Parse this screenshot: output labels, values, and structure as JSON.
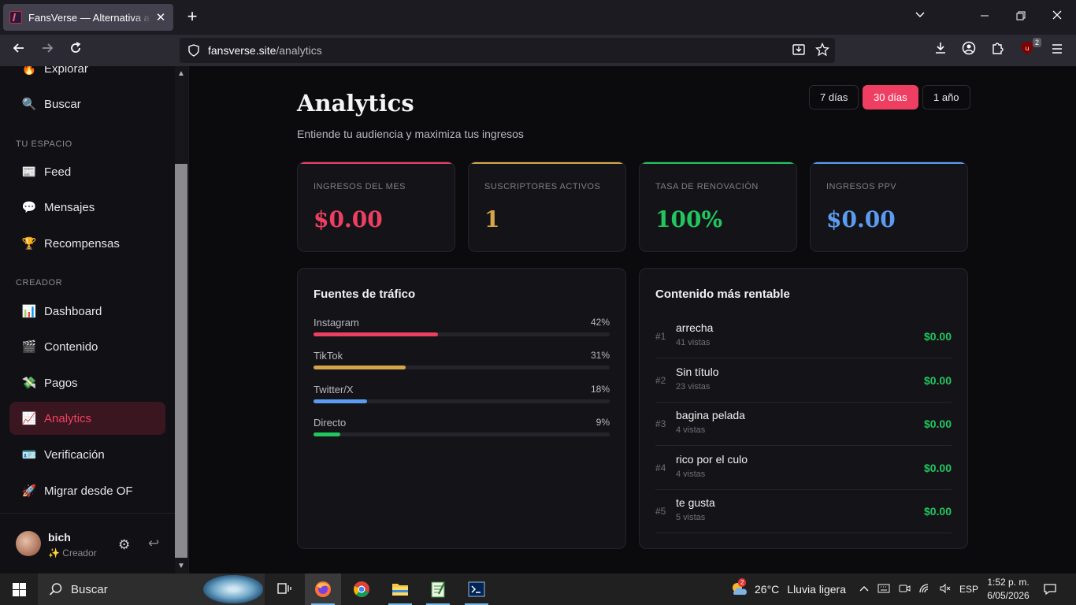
{
  "browser": {
    "tab_title": "FansVerse — Alternativa a OnlyFans",
    "url_host": "fansverse.site",
    "url_path": "/analytics",
    "extension_badge": "2"
  },
  "sidebar": {
    "items": [
      {
        "icon": "🔥",
        "label": "Explorar"
      },
      {
        "icon": "🔍",
        "label": "Buscar"
      },
      {
        "icon": "📰",
        "label": "Feed"
      },
      {
        "icon": "💬",
        "label": "Mensajes"
      },
      {
        "icon": "🏆",
        "label": "Recompensas"
      },
      {
        "icon": "📊",
        "label": "Dashboard"
      },
      {
        "icon": "🎬",
        "label": "Contenido"
      },
      {
        "icon": "💸",
        "label": "Pagos"
      },
      {
        "icon": "📈",
        "label": "Analytics"
      },
      {
        "icon": "🪪",
        "label": "Verificación"
      },
      {
        "icon": "🚀",
        "label": "Migrar desde OF"
      }
    ],
    "section_space": "TU ESPACIO",
    "section_creator": "CREADOR",
    "user": {
      "name": "bich",
      "role_icon": "✨",
      "role": "Creador"
    }
  },
  "main": {
    "title": "Analytics",
    "subtitle": "Entiende tu audiencia y maximiza tus ingresos",
    "ranges": [
      "7 días",
      "30 días",
      "1 año"
    ],
    "selected_range": "30 días",
    "kpis": [
      {
        "label": "INGRESOS DEL MES",
        "value": "$0.00",
        "color": "#ee3f63"
      },
      {
        "label": "SUSCRIPTORES ACTIVOS",
        "value": "1",
        "color": "#d4a64a"
      },
      {
        "label": "TASA DE RENOVACIÓN",
        "value": "100%",
        "color": "#22c55e"
      },
      {
        "label": "INGRESOS PPV",
        "value": "$0.00",
        "color": "#5b9cf2"
      }
    ],
    "traffic": {
      "title": "Fuentes de tráfico",
      "sources": [
        {
          "name": "Instagram",
          "pct": "42%",
          "value": 42,
          "color": "#ee3f63"
        },
        {
          "name": "TikTok",
          "pct": "31%",
          "value": 31,
          "color": "#d4a64a"
        },
        {
          "name": "Twitter/X",
          "pct": "18%",
          "value": 18,
          "color": "#5b9cf2"
        },
        {
          "name": "Directo",
          "pct": "9%",
          "value": 9,
          "color": "#22c55e"
        }
      ]
    },
    "top_content": {
      "title": "Contenido más rentable",
      "items": [
        {
          "rank": "#1",
          "title": "arrecha",
          "views": "41 vistas",
          "earnings": "$0.00"
        },
        {
          "rank": "#2",
          "title": "Sin título",
          "views": "23 vistas",
          "earnings": "$0.00"
        },
        {
          "rank": "#3",
          "title": "bagina pelada",
          "views": "4 vistas",
          "earnings": "$0.00"
        },
        {
          "rank": "#4",
          "title": "rico por el culo",
          "views": "4 vistas",
          "earnings": "$0.00"
        },
        {
          "rank": "#5",
          "title": "te gusta",
          "views": "5 vistas",
          "earnings": "$0.00"
        }
      ]
    }
  },
  "taskbar": {
    "search_placeholder": "Buscar",
    "weather_badge": "2",
    "temperature": "26°C",
    "weather": "Lluvia ligera",
    "language": "ESP",
    "time": "1:52 p. m.",
    "date": "6/05/2026"
  }
}
